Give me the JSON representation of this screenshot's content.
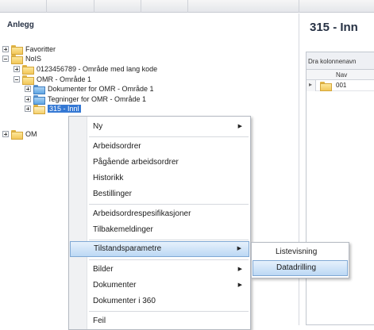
{
  "left_panel": {
    "title": "Anlegg",
    "tree": [
      {
        "label": "Favoritter"
      },
      {
        "label": "NoIS"
      },
      {
        "label": "0123456789 - Område med lang kode"
      },
      {
        "label": "OMR - Område 1"
      },
      {
        "label": "Dokumenter for OMR - Område 1"
      },
      {
        "label": "Tegninger for OMR - Område 1"
      },
      {
        "label": "315 - Innl"
      },
      {
        "label": "OM"
      }
    ]
  },
  "right_panel": {
    "title": "315 - Inn",
    "group_bar_text": "Dra kolonnenavn",
    "column_header": "Nav",
    "row_cell": "001"
  },
  "context_menu": {
    "items": [
      {
        "label": "Ny",
        "has_submenu": true
      },
      {
        "label": "Arbeidsordrer"
      },
      {
        "label": "Pågående arbeidsordrer"
      },
      {
        "label": "Historikk"
      },
      {
        "label": "Bestillinger"
      },
      {
        "label": "Arbeidsordrespesifikasjoner"
      },
      {
        "label": "Tilbakemeldinger"
      },
      {
        "label": "Tilstandsparametre",
        "has_submenu": true,
        "highlighted": true
      },
      {
        "label": "Bilder",
        "has_submenu": true
      },
      {
        "label": "Dokumenter",
        "has_submenu": true
      },
      {
        "label": "Dokumenter i 360"
      },
      {
        "label": "Feil"
      }
    ],
    "submenu_arrow": "▶"
  },
  "submenu": {
    "items": [
      {
        "label": "Listevisning"
      },
      {
        "label": "Datadrilling",
        "highlighted": true
      }
    ]
  },
  "tree_expand_glyph": "▸",
  "colors": {
    "selection": "#3478d4",
    "menu_highlight": "#bcd8f4",
    "panel_title": "#263144"
  }
}
